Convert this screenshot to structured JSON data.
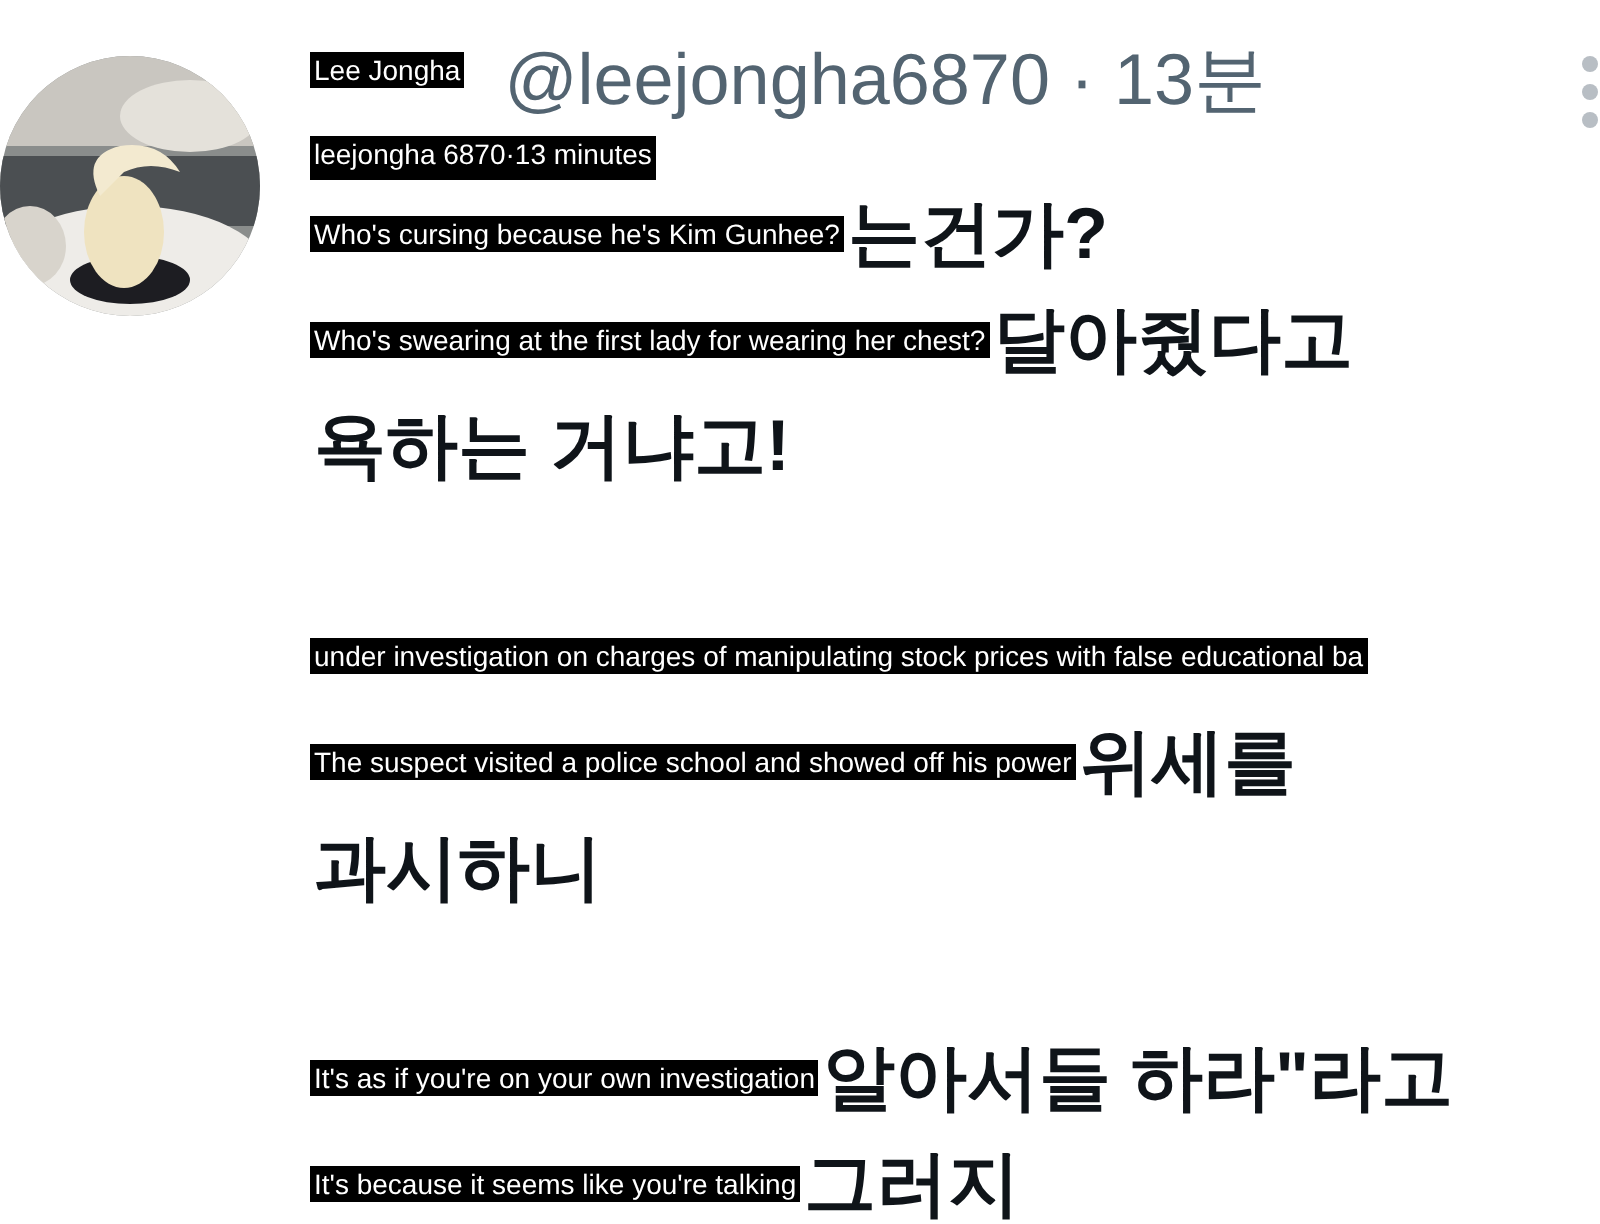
{
  "avatar": {
    "kind": "picture"
  },
  "header": {
    "name_translation": "Lee Jongha",
    "handle_time": "@leejongha6870 · 13분",
    "meta_translation": "leejongha 6870·13 minutes"
  },
  "paragraphs": [
    [
      {
        "translation": "Who's cursing because he's Kim Gunhee?",
        "text": "는건가?"
      },
      {
        "translation": "Who's swearing at the first lady for wearing her chest?",
        "text": "달아줬다고"
      },
      {
        "text": "욕하는 거냐고!"
      }
    ],
    [
      {
        "translation": "under investigation on charges of manipulating stock prices with false educational ba"
      },
      {
        "translation": "The suspect visited a police school and showed off his power",
        "text": "위세를"
      },
      {
        "text": "과시하니"
      }
    ],
    [
      {
        "translation": "It's as if you're on your own investigation",
        "text": "알아서들 하라\"라고"
      },
      {
        "translation": "It's because it seems like you're talking",
        "text": "그러지"
      }
    ]
  ]
}
